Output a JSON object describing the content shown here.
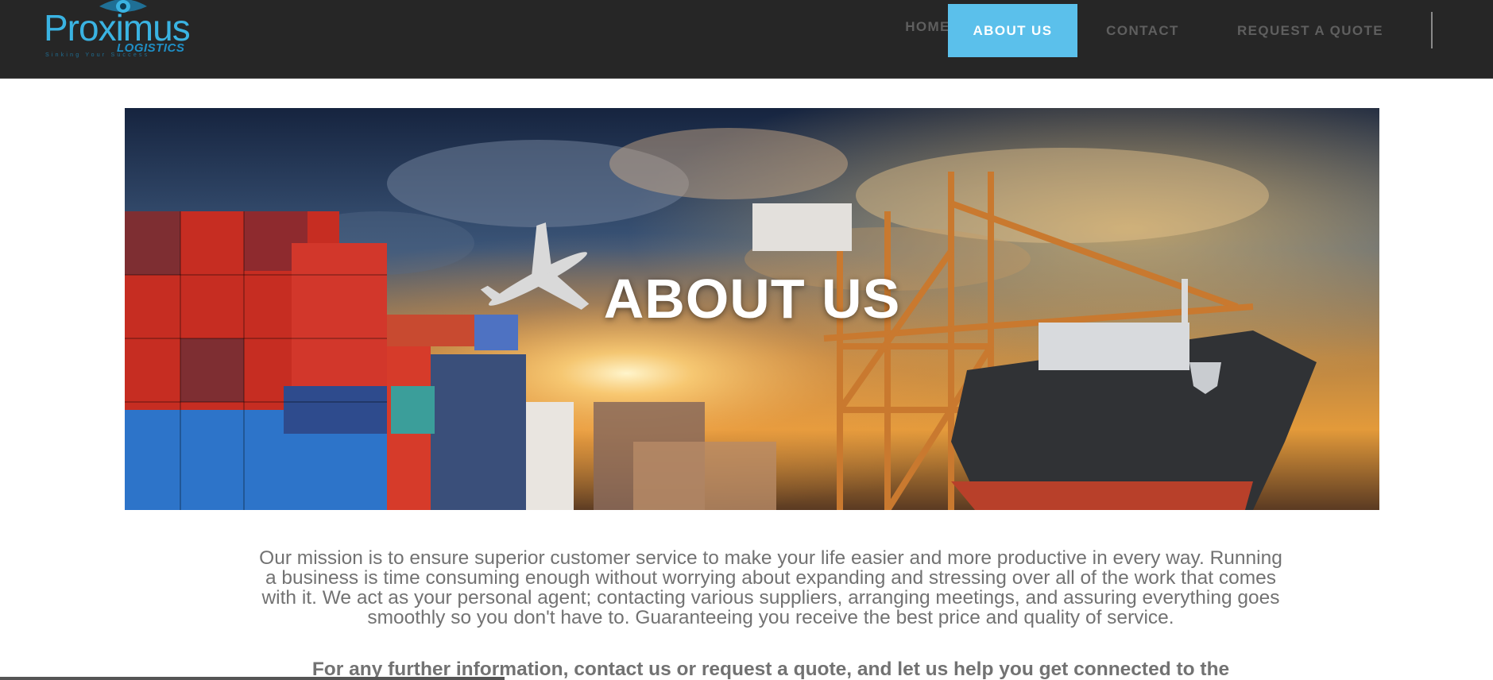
{
  "brand": {
    "name": "Proximus",
    "subtitle": "LOGISTICS",
    "tagline": "Sinking Your Success",
    "colors": {
      "primary": "#3ab3e2",
      "dark": "#1f8fc6"
    }
  },
  "nav": {
    "items": [
      {
        "label": "HOME",
        "active": false
      },
      {
        "label": "ABOUT US",
        "active": true
      },
      {
        "label": "CONTACT",
        "active": false
      },
      {
        "label": "REQUEST A QUOTE",
        "active": false
      }
    ],
    "active_color": "#5bc0eb",
    "background": "#262626"
  },
  "hero": {
    "title": "ABOUT US",
    "image": "cargo-port-sunset-illustration"
  },
  "content": {
    "mission": "Our mission is to ensure superior customer service to make your life easier and more productive in every way. Running a business is time consuming enough without worrying about expanding and stressing over all of the work that comes with it. We act as your personal agent; contacting various suppliers, arranging meetings, and assuring everything goes smoothly so you don't have to. Guaranteeing you receive the best price and quality of service.",
    "cta": "For any further information, contact us or request a quote, and let us help you get connected to the"
  }
}
